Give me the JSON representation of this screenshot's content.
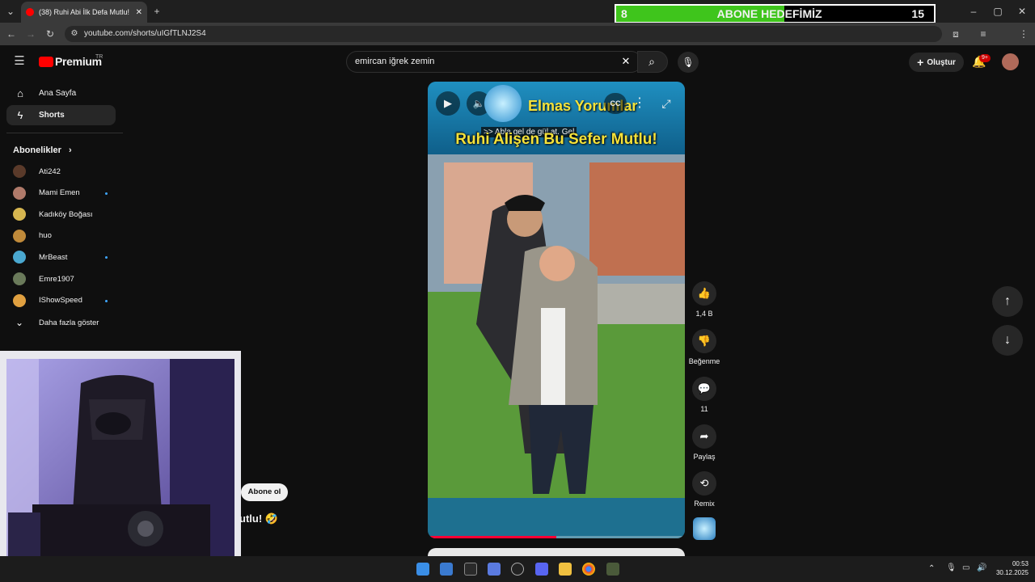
{
  "browser": {
    "tab_title": "(38) Ruhi Abi İlk Defa Mutlu! 🤣",
    "url": "youtube.com/shorts/uIGfTLNJ2S4"
  },
  "goal_overlay": {
    "current": "8",
    "label": "ABONE HEDEFİMİZ",
    "target": "15",
    "progress": 0.53,
    "fill_color": "#3fc51c"
  },
  "youtube": {
    "logo_text": "Premium",
    "region": "TR",
    "search_value": "emircan iğrek zemin",
    "create_label": "Oluştur",
    "notif_badge": "9+"
  },
  "sidebar": {
    "items": [
      {
        "label": "Ana Sayfa",
        "icon": "home-icon"
      },
      {
        "label": "Shorts",
        "icon": "shorts-icon"
      }
    ],
    "subs_title": "Abonelikler",
    "subscriptions": [
      {
        "name": "Ati242",
        "color": "#5a3a2a",
        "dot": false
      },
      {
        "name": "Mami Emen",
        "color": "#b07a6a",
        "dot": true
      },
      {
        "name": "Kadıköy Boğası",
        "color": "#d6b650",
        "dot": false
      },
      {
        "name": "huo",
        "color": "#c08a3a",
        "dot": false
      },
      {
        "name": "MrBeast",
        "color": "#4aa8d0",
        "dot": true
      },
      {
        "name": "Emre1907",
        "color": "#6a7a5a",
        "dot": false
      },
      {
        "name": "IShowSpeed",
        "color": "#e0a040",
        "dot": true
      }
    ],
    "show_more": "Daha fazla göster"
  },
  "video": {
    "channel_overlay": "Elmas Yorumlar",
    "caption": ">> Abla gel de gül at. Gel",
    "title_overlay": "Ruhi Alişen Bu Sefer Mutlu!",
    "title_partial": "utlu! 🤣",
    "subscribe": "Abone ol",
    "progress": 0.5
  },
  "actions": [
    {
      "label": "1,4 B",
      "icon": "like-icon",
      "glyph": "👍"
    },
    {
      "label": "Beğenme",
      "icon": "dislike-icon",
      "glyph": "👎"
    },
    {
      "label": "11",
      "icon": "comment-icon",
      "glyph": "💬"
    },
    {
      "label": "Paylaş",
      "icon": "share-icon",
      "glyph": "➦"
    },
    {
      "label": "Remix",
      "icon": "remix-icon",
      "glyph": "⟲"
    }
  ],
  "taskbar": {
    "time": "00:53",
    "date": "30.12.2025"
  }
}
